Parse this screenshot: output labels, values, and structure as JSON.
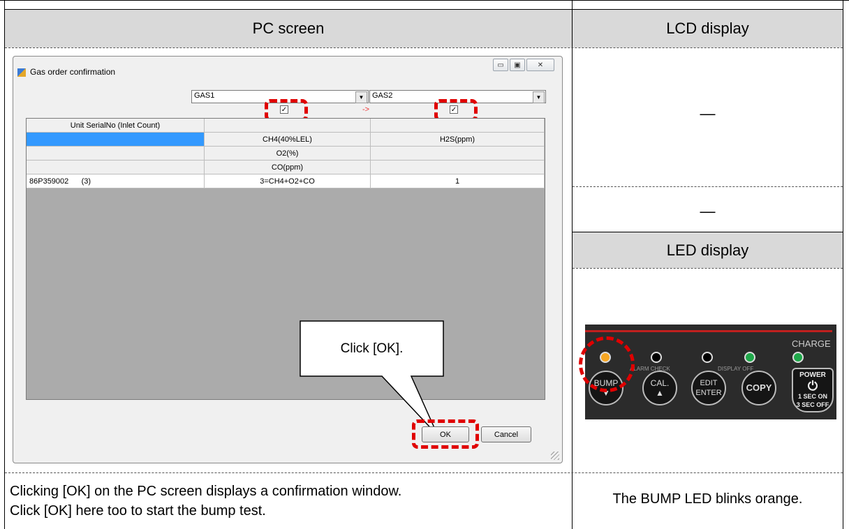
{
  "headers": {
    "pc_screen": "PC screen",
    "lcd_display": "LCD display",
    "led_display": "LED display"
  },
  "lcd": {
    "row1": "—",
    "row2": "—"
  },
  "window": {
    "title": "Gas order confirmation",
    "controls": {
      "minimize": "▭",
      "maximize": "▣",
      "close": "✕"
    },
    "combo_left": "GAS1",
    "combo_right": "GAS2",
    "arrow": "->",
    "check_mark": "✓",
    "grid": {
      "header": "Unit SerialNo (Inlet Count)",
      "rows": [
        [
          "",
          "CH4(40%LEL)",
          "H2S(ppm)"
        ],
        [
          "",
          "O2(%)",
          ""
        ],
        [
          "",
          "CO(ppm)",
          ""
        ],
        [
          "86P359002      (3)",
          "3=CH4+O2+CO",
          "1"
        ]
      ]
    },
    "ok_label": "OK",
    "cancel_label": "Cancel"
  },
  "callout": "Click [OK].",
  "led_panel": {
    "charge": "CHARGE",
    "alarm_check": "ALARM CHECK",
    "display_off": "DISPLAY OFF",
    "bump": "BUMP",
    "bump_arrow": "▼",
    "cal": "CAL.",
    "cal_arrow": "▲",
    "edit": "EDIT",
    "enter": "ENTER",
    "copy": "COPY",
    "power": "POWER",
    "power_sym": "⏻",
    "power_sub1": "1 SEC ON",
    "power_sub2": "3 SEC OFF",
    "colors": {
      "bump_led": "#f5a623",
      "alarm_led": "#000000",
      "edit_led": "#000000",
      "copy_led": "#1fa84a",
      "charge_led": "#1fa84a"
    }
  },
  "bottom": {
    "left_line1": "Clicking [OK] on the PC screen displays a confirmation window.",
    "left_line2": "Click [OK] here too to start the bump test.",
    "right": "The BUMP LED blinks orange."
  }
}
